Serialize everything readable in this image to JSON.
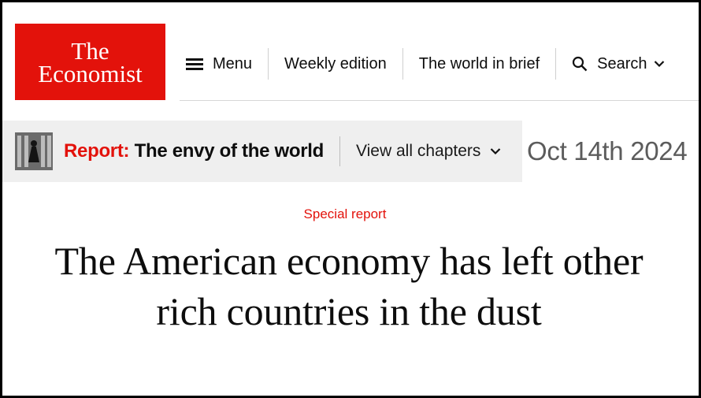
{
  "logo": {
    "line1": "The",
    "line2": "Economist"
  },
  "nav": {
    "menu": "Menu",
    "weekly": "Weekly edition",
    "brief": "The world in brief",
    "search": "Search"
  },
  "report": {
    "kicker": "Report:",
    "title": "The envy of the world",
    "view_chapters": "View all chapters"
  },
  "date": "Oct 14th 2024",
  "article": {
    "section": "Special report",
    "headline": "The American economy has left other rich countries in the dust"
  },
  "colors": {
    "brand_red": "#e3120b",
    "banner_bg": "#efefef"
  },
  "icons": [
    "menu-icon",
    "search-icon",
    "chevron-down-icon"
  ]
}
